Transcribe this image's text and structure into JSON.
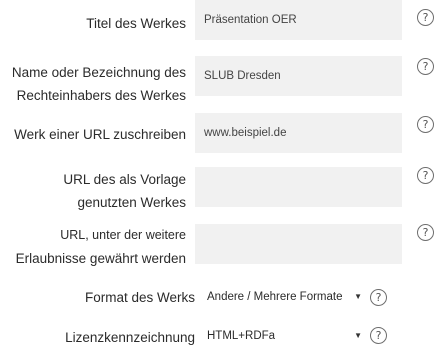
{
  "fields": [
    {
      "label": [
        "Titel des Werkes"
      ],
      "value": "Präsentation OER"
    },
    {
      "label": [
        "Name oder Bezeichnung des",
        "Rechteinhabers des Werkes"
      ],
      "value": "SLUB Dresden"
    },
    {
      "label": [
        "Werk einer URL zuschreiben"
      ],
      "value": "www.beispiel.de"
    },
    {
      "label": [
        "URL des als Vorlage",
        "genutzten Werkes"
      ],
      "value": ""
    },
    {
      "label": [
        "URL, unter der weitere",
        "Erlaubnisse gewährt werden"
      ],
      "value": ""
    }
  ],
  "selects": [
    {
      "label": "Format des Werks",
      "value": "Andere / Mehrere Formate"
    },
    {
      "label": "Lizenzkennzeichnung",
      "value": "HTML+RDFa"
    }
  ],
  "help_glyph": "?",
  "caret_glyph": "▼",
  "icons": {
    "help": "question-circle-icon",
    "dropdown": "caret-down-icon"
  }
}
